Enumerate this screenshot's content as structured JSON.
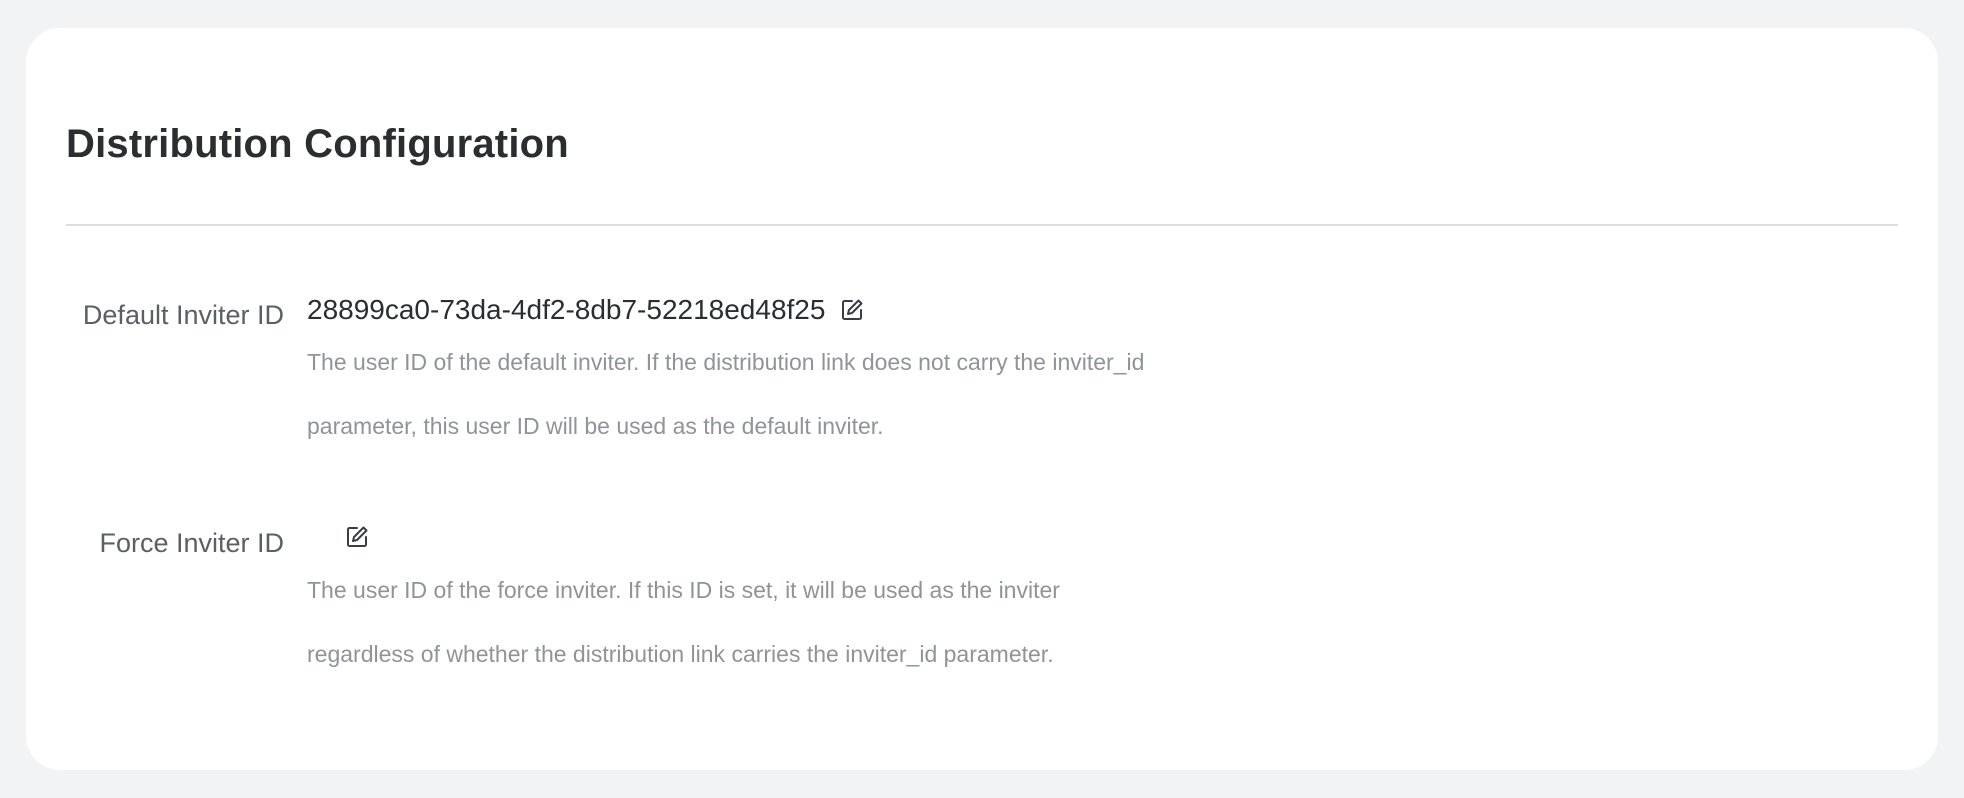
{
  "page": {
    "title": "Distribution Configuration"
  },
  "settings": [
    {
      "label": "Default Inviter ID",
      "value": "28899ca0-73da-4df2-8db7-52218ed48f25",
      "help_lines": [
        "The user ID of the default inviter. If the distribution link does not carry the inviter_id",
        "parameter, this user ID will be used as the default inviter."
      ],
      "icon": "edit-icon"
    },
    {
      "label": "Force Inviter ID",
      "value": "",
      "help_lines": [
        "The user ID of the force inviter. If this ID is set, it will be used as the inviter",
        "regardless of whether the distribution link carries the inviter_id parameter."
      ],
      "icon": "edit-icon"
    }
  ],
  "colors": {
    "background": "#f2f3f5",
    "card": "#ffffff",
    "title": "#2b2d31",
    "label": "#5b5f66",
    "help": "#8f939a"
  }
}
